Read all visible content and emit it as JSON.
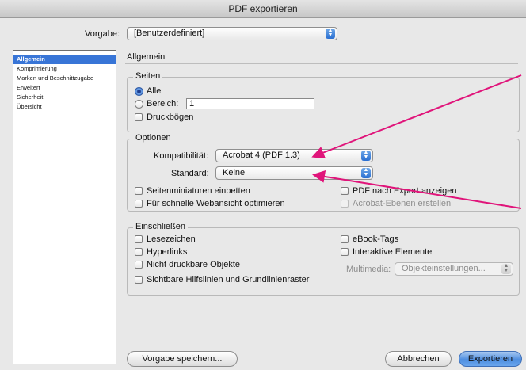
{
  "window": {
    "title": "PDF exportieren"
  },
  "preset": {
    "label": "Vorgabe:",
    "value": "[Benutzerdefiniert]"
  },
  "sidebar": {
    "items": [
      "Allgemein",
      "Komprimierung",
      "Marken und Beschnittzugabe",
      "Erweitert",
      "Sicherheit",
      "Übersicht"
    ],
    "selected": "Allgemein"
  },
  "main": {
    "section_title": "Allgemein",
    "pages": {
      "legend": "Seiten",
      "all_label": "Alle",
      "range_label": "Bereich:",
      "range_value": "1",
      "spreads_label": "Druckbögen",
      "selected": "Alle"
    },
    "options": {
      "legend": "Optionen",
      "compat_label": "Kompatibilität:",
      "compat_value": "Acrobat 4 (PDF 1.3)",
      "standard_label": "Standard:",
      "standard_value": "Keine",
      "thumbnails_label": "Seitenminiaturen einbetten",
      "fastweb_label": "Für schnelle Webansicht optimieren",
      "viewpdf_label": "PDF nach Export anzeigen",
      "acrobat_layers_label": "Acrobat-Ebenen erstellen"
    },
    "include": {
      "legend": "Einschließen",
      "bookmarks_label": "Lesezeichen",
      "hyperlinks_label": "Hyperlinks",
      "nonprint_label": "Nicht druckbare Objekte",
      "guides_label": "Sichtbare Hilfslinien und Grundlinienraster",
      "ebook_label": "eBook-Tags",
      "interactive_label": "Interaktive Elemente",
      "multimedia_label": "Multimedia:",
      "multimedia_value": "Objekteinstellungen..."
    }
  },
  "footer": {
    "save_preset": "Vorgabe speichern...",
    "cancel": "Abbrechen",
    "export": "Exportieren"
  },
  "colors": {
    "accent": "#3875d7",
    "annotation_arrow": "#e0147a"
  }
}
